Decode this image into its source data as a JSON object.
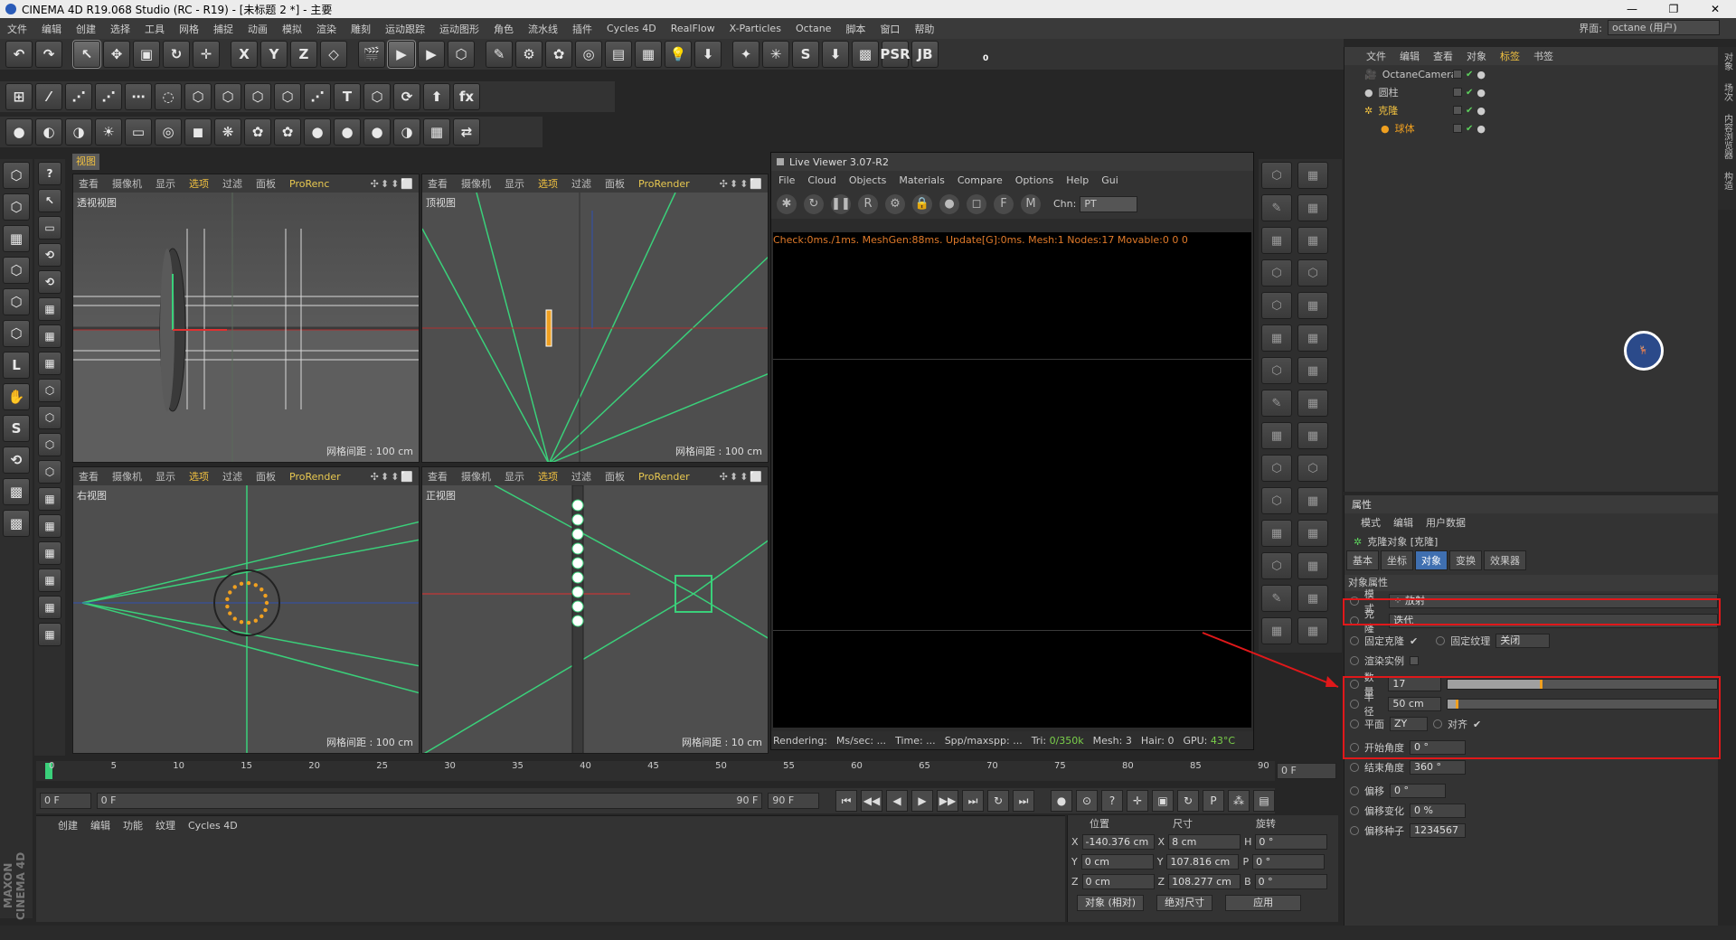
{
  "window": {
    "title": "CINEMA 4D R19.068 Studio (RC - R19) - [未标题 2 *] - 主要",
    "controls": [
      "—",
      "❐",
      "✕"
    ]
  },
  "menubar": {
    "items": [
      "文件",
      "编辑",
      "创建",
      "选择",
      "工具",
      "网格",
      "捕捉",
      "动画",
      "模拟",
      "渲染",
      "雕刻",
      "运动跟踪",
      "运动图形",
      "角色",
      "流水线",
      "插件",
      "Cycles 4D",
      "RealFlow",
      "X-Particles",
      "Octane",
      "脚本",
      "窗口",
      "帮助"
    ],
    "interface_label": "界面:",
    "interface_value": "octane (用户)"
  },
  "toolbar": {
    "row1": [
      "↶",
      "↷",
      "↖",
      "✥",
      "▣",
      "↻",
      "✛",
      "X",
      "Y",
      "Z",
      "◇",
      "🎬",
      "▶",
      "▶",
      "⬡",
      "✎",
      "⚙",
      "✿",
      "◎",
      "▤",
      "▦",
      "💡",
      "⬇",
      "✦",
      "✳",
      "S",
      "⬇",
      "▩",
      "PSR",
      "JB"
    ],
    "row2": [
      "⊞",
      "⁄",
      "⋰",
      "⋰",
      "⋯",
      "◌",
      "⬡",
      "⬡",
      "⬡",
      "⬡",
      "⋰",
      "T",
      "⬡",
      "⟳",
      "⬆",
      "fx"
    ],
    "row3": [
      "●",
      "◐",
      "◑",
      "☀",
      "▭",
      "◎",
      "◼",
      "❋",
      "✿",
      "✿",
      "●",
      "●",
      "●",
      "◑",
      "▦",
      "⇄"
    ],
    "psr_value": "0"
  },
  "viewports": {
    "header_items": [
      "查看",
      "摄像机",
      "显示",
      "选项",
      "过滤",
      "面板"
    ],
    "active_item": "选项",
    "renderer_label": "ProRender",
    "renderer_label_short": "ProRenc",
    "controls": "✣⬍⬍⬜",
    "tab_label": "视图",
    "perspective": {
      "label": "透视视图",
      "grid": "网格间距 : 100 cm"
    },
    "top": {
      "label": "顶视图",
      "grid": "网格间距 : 100 cm"
    },
    "right": {
      "label": "右视图",
      "grid": "网格间距 : 100 cm"
    },
    "front": {
      "label": "正视图",
      "grid": "网格间距 : 10 cm"
    }
  },
  "live_viewer": {
    "title": "Live Viewer 3.07-R2",
    "menu": [
      "File",
      "Cloud",
      "Objects",
      "Materials",
      "Compare",
      "Options",
      "Help",
      "Gui"
    ],
    "channel_label": "Chn:",
    "channel_value": "PT",
    "status": "Check:0ms./1ms. MeshGen:88ms. Update[G]:0ms. Mesh:1 Nodes:17 Movable:0  0 0",
    "bottom": {
      "rendering": "Rendering:",
      "ms_sec": "Ms/sec: ...",
      "time": "Time: ...",
      "spp": "Spp/maxspp: ...",
      "tri_label": "Tri:",
      "tri_value": "0/350k",
      "mesh": "Mesh: 3",
      "hair": "Hair: 0",
      "gpu_label": "GPU:",
      "gpu_value": "43°C"
    }
  },
  "object_manager": {
    "menu": [
      "文件",
      "编辑",
      "查看",
      "对象",
      "标签",
      "书签"
    ],
    "active_menu": "标签",
    "objects": [
      {
        "name": "OctaneCamera",
        "color": "#c8c8c8"
      },
      {
        "name": "圆柱",
        "color": "#c8c8c8"
      },
      {
        "name": "克隆",
        "color": "#f0c040"
      },
      {
        "name": "球体",
        "color": "#f0a020"
      }
    ],
    "side_tabs": [
      "对象",
      "场次",
      "内容浏览器",
      "构造"
    ]
  },
  "attributes": {
    "title": "属性",
    "menu": [
      "模式",
      "编辑",
      "用户数据"
    ],
    "object_title": "克隆对象 [克隆]",
    "tabs": [
      "基本",
      "坐标",
      "对象",
      "变换",
      "效果器"
    ],
    "active_tab": "对象",
    "section": "对象属性",
    "mode_label": "模式",
    "mode_value": "放射",
    "clone_label": "克隆",
    "clone_value": "迭代",
    "fix_clone_label": "固定克隆",
    "fix_texture_label": "固定纹理",
    "fix_texture_value": "关闭",
    "render_instances_label": "渲染实例",
    "count_label": "数量",
    "count_value": "17",
    "count_fraction": 0.35,
    "radius_label": "半径",
    "radius_value": "50 cm",
    "radius_fraction": 0.04,
    "plane_label": "平面",
    "plane_value": "ZY",
    "align_label": "对齐",
    "start_angle_label": "开始角度",
    "start_angle_value": "0 °",
    "end_angle_label": "结束角度",
    "end_angle_value": "360 °",
    "offset_label": "偏移",
    "offset_value": "0 °",
    "offset_var_label": "偏移变化",
    "offset_var_value": "0 %",
    "offset_seed_label": "偏移种子",
    "offset_seed_value": "1234567"
  },
  "timeline": {
    "ticks": [
      "0",
      "5",
      "10",
      "15",
      "20",
      "25",
      "30",
      "35",
      "40",
      "45",
      "50",
      "55",
      "60",
      "65",
      "70",
      "75",
      "80",
      "85",
      "90"
    ],
    "current_frame": "0 F",
    "start_frame": "0 F",
    "range_start": "0 F",
    "range_end": "90 F",
    "end_frame": "90 F",
    "transport": [
      "⏮",
      "◀◀",
      "◀",
      "▶",
      "▶▶",
      "⏭",
      "↻",
      "⏭"
    ],
    "key_buttons": [
      "●",
      "⊙",
      "?",
      "✛",
      "▣",
      "↻",
      "P",
      "⁂",
      "▤"
    ]
  },
  "material_manager": {
    "menu": [
      "创建",
      "编辑",
      "功能",
      "纹理",
      "Cycles 4D"
    ],
    "brand": "MAXON CINEMA 4D"
  },
  "coordinates": {
    "headers": [
      "位置",
      "尺寸",
      "旋转"
    ],
    "rows": [
      {
        "axis": "X",
        "pos": "-140.376 cm",
        "saxis": "X",
        "size": "8 cm",
        "raxis": "H",
        "rot": "0 °"
      },
      {
        "axis": "Y",
        "pos": "0 cm",
        "saxis": "Y",
        "size": "107.816 cm",
        "raxis": "P",
        "rot": "0 °"
      },
      {
        "axis": "Z",
        "pos": "0 cm",
        "saxis": "Z",
        "size": "108.277 cm",
        "raxis": "B",
        "rot": "0 °"
      }
    ],
    "mode_value": "对象 (相对)",
    "size_mode_value": "绝对尺寸",
    "apply_label": "应用"
  },
  "colors": {
    "accent_yellow": "#f0c040",
    "highlight_red": "#e0181a",
    "spline_green": "#3ad07a",
    "active_tab_blue": "#3f6fb0"
  }
}
